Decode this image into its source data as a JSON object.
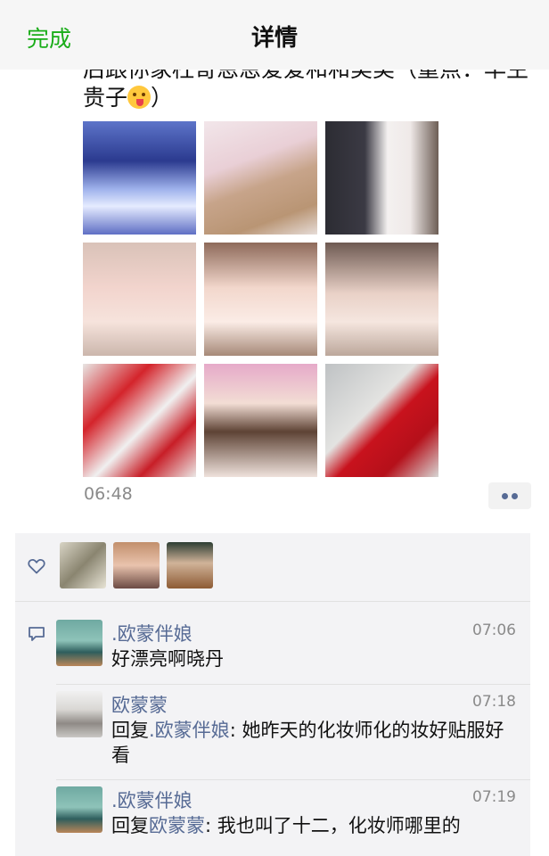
{
  "nav": {
    "done_label": "完成",
    "title": "详情"
  },
  "post": {
    "text": "后跟你家枉哥恩恩爱爱和和美美（重点：早生贵子",
    "text_end": "）",
    "emoji_icon": "winking-face-tongue-icon",
    "photo_count": 9,
    "time": "06:48",
    "more_icon": "more-dots-icon"
  },
  "likes": {
    "icon": "heart-icon",
    "avatar_count": 3
  },
  "comments_icon": "comment-icon",
  "comments": [
    {
      "name": ".欧蒙伴娘",
      "time": "07:06",
      "text": "好漂亮啊晓丹"
    },
    {
      "name": "欧蒙蒙",
      "time": "07:18",
      "reply_prefix": "回复",
      "reply_to": ".欧蒙伴娘",
      "text": ": 她昨天的化妆师化的妆好贴服好看"
    },
    {
      "name": ".欧蒙伴娘",
      "time": "07:19",
      "reply_prefix": "回复",
      "reply_to": "欧蒙蒙",
      "text": ": 我也叫了十二，化妆师哪里的"
    }
  ],
  "colors": {
    "accent_green": "#1aad19",
    "link_blue": "#576b95",
    "panel_bg": "#f3f3f5"
  }
}
